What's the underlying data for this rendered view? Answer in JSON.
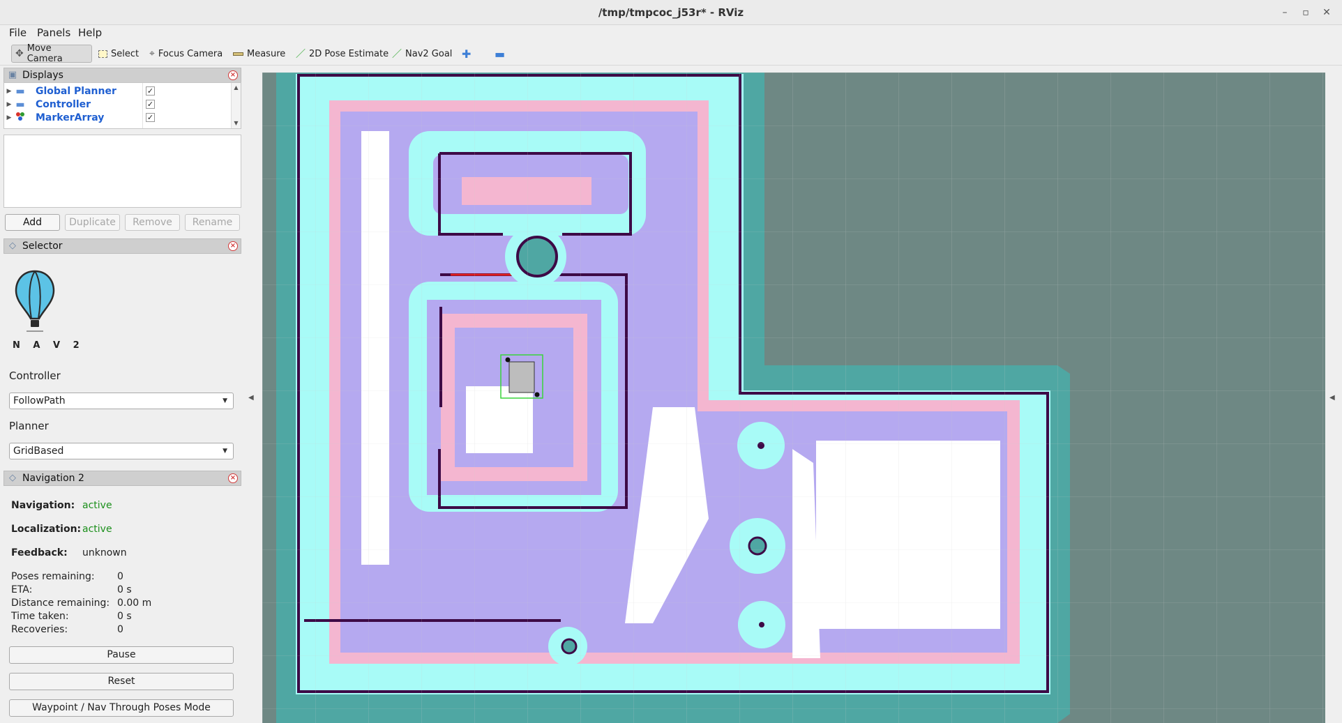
{
  "window": {
    "title": "/tmp/tmpcoc_j53r* - RViz"
  },
  "menu": {
    "file": "File",
    "panels": "Panels",
    "help": "Help"
  },
  "toolbar": {
    "move_camera": "Move Camera",
    "select": "Select",
    "focus_camera": "Focus Camera",
    "measure": "Measure",
    "pose_estimate": "2D Pose Estimate",
    "nav2_goal": "Nav2 Goal"
  },
  "displays": {
    "title": "Displays",
    "items": [
      {
        "label": "Global Planner",
        "checked": true,
        "icon": "folder-icon"
      },
      {
        "label": "Controller",
        "checked": true,
        "icon": "folder-icon"
      },
      {
        "label": "MarkerArray",
        "checked": true,
        "icon": "marker-icon"
      }
    ],
    "buttons": {
      "add": "Add",
      "duplicate": "Duplicate",
      "remove": "Remove",
      "rename": "Rename"
    }
  },
  "selector": {
    "title": "Selector",
    "logo_text": "N A V 2",
    "controller_label": "Controller",
    "controller_value": "FollowPath",
    "planner_label": "Planner",
    "planner_value": "GridBased"
  },
  "navigation": {
    "title": "Navigation 2",
    "navigation_label": "Navigation:",
    "navigation_value": "active",
    "localization_label": "Localization:",
    "localization_value": "active",
    "feedback_label": "Feedback:",
    "feedback_value": "unknown",
    "poses_label": "Poses remaining:",
    "poses_value": "0",
    "eta_label": "ETA:",
    "eta_value": "0 s",
    "distance_label": "Distance remaining:",
    "distance_value": "0.00 m",
    "time_label": "Time taken:",
    "time_value": "0 s",
    "recoveries_label": "Recoveries:",
    "recoveries_value": "0",
    "pause": "Pause",
    "reset": "Reset",
    "waypoint_mode": "Waypoint / Nav Through Poses Mode"
  },
  "colors": {
    "view_background": "#6e8884",
    "costmap_outer": "#4fa7a3",
    "costmap_inflation": "#a8fbf7",
    "costmap_gradient": "#b5a9f0",
    "costmap_lethal_edge": "#f4b6d0",
    "wall": "#3d0a46",
    "robot_footprint": "#39d43a",
    "active_text": "#1b8f1b",
    "display_label": "#1f5fd1"
  }
}
